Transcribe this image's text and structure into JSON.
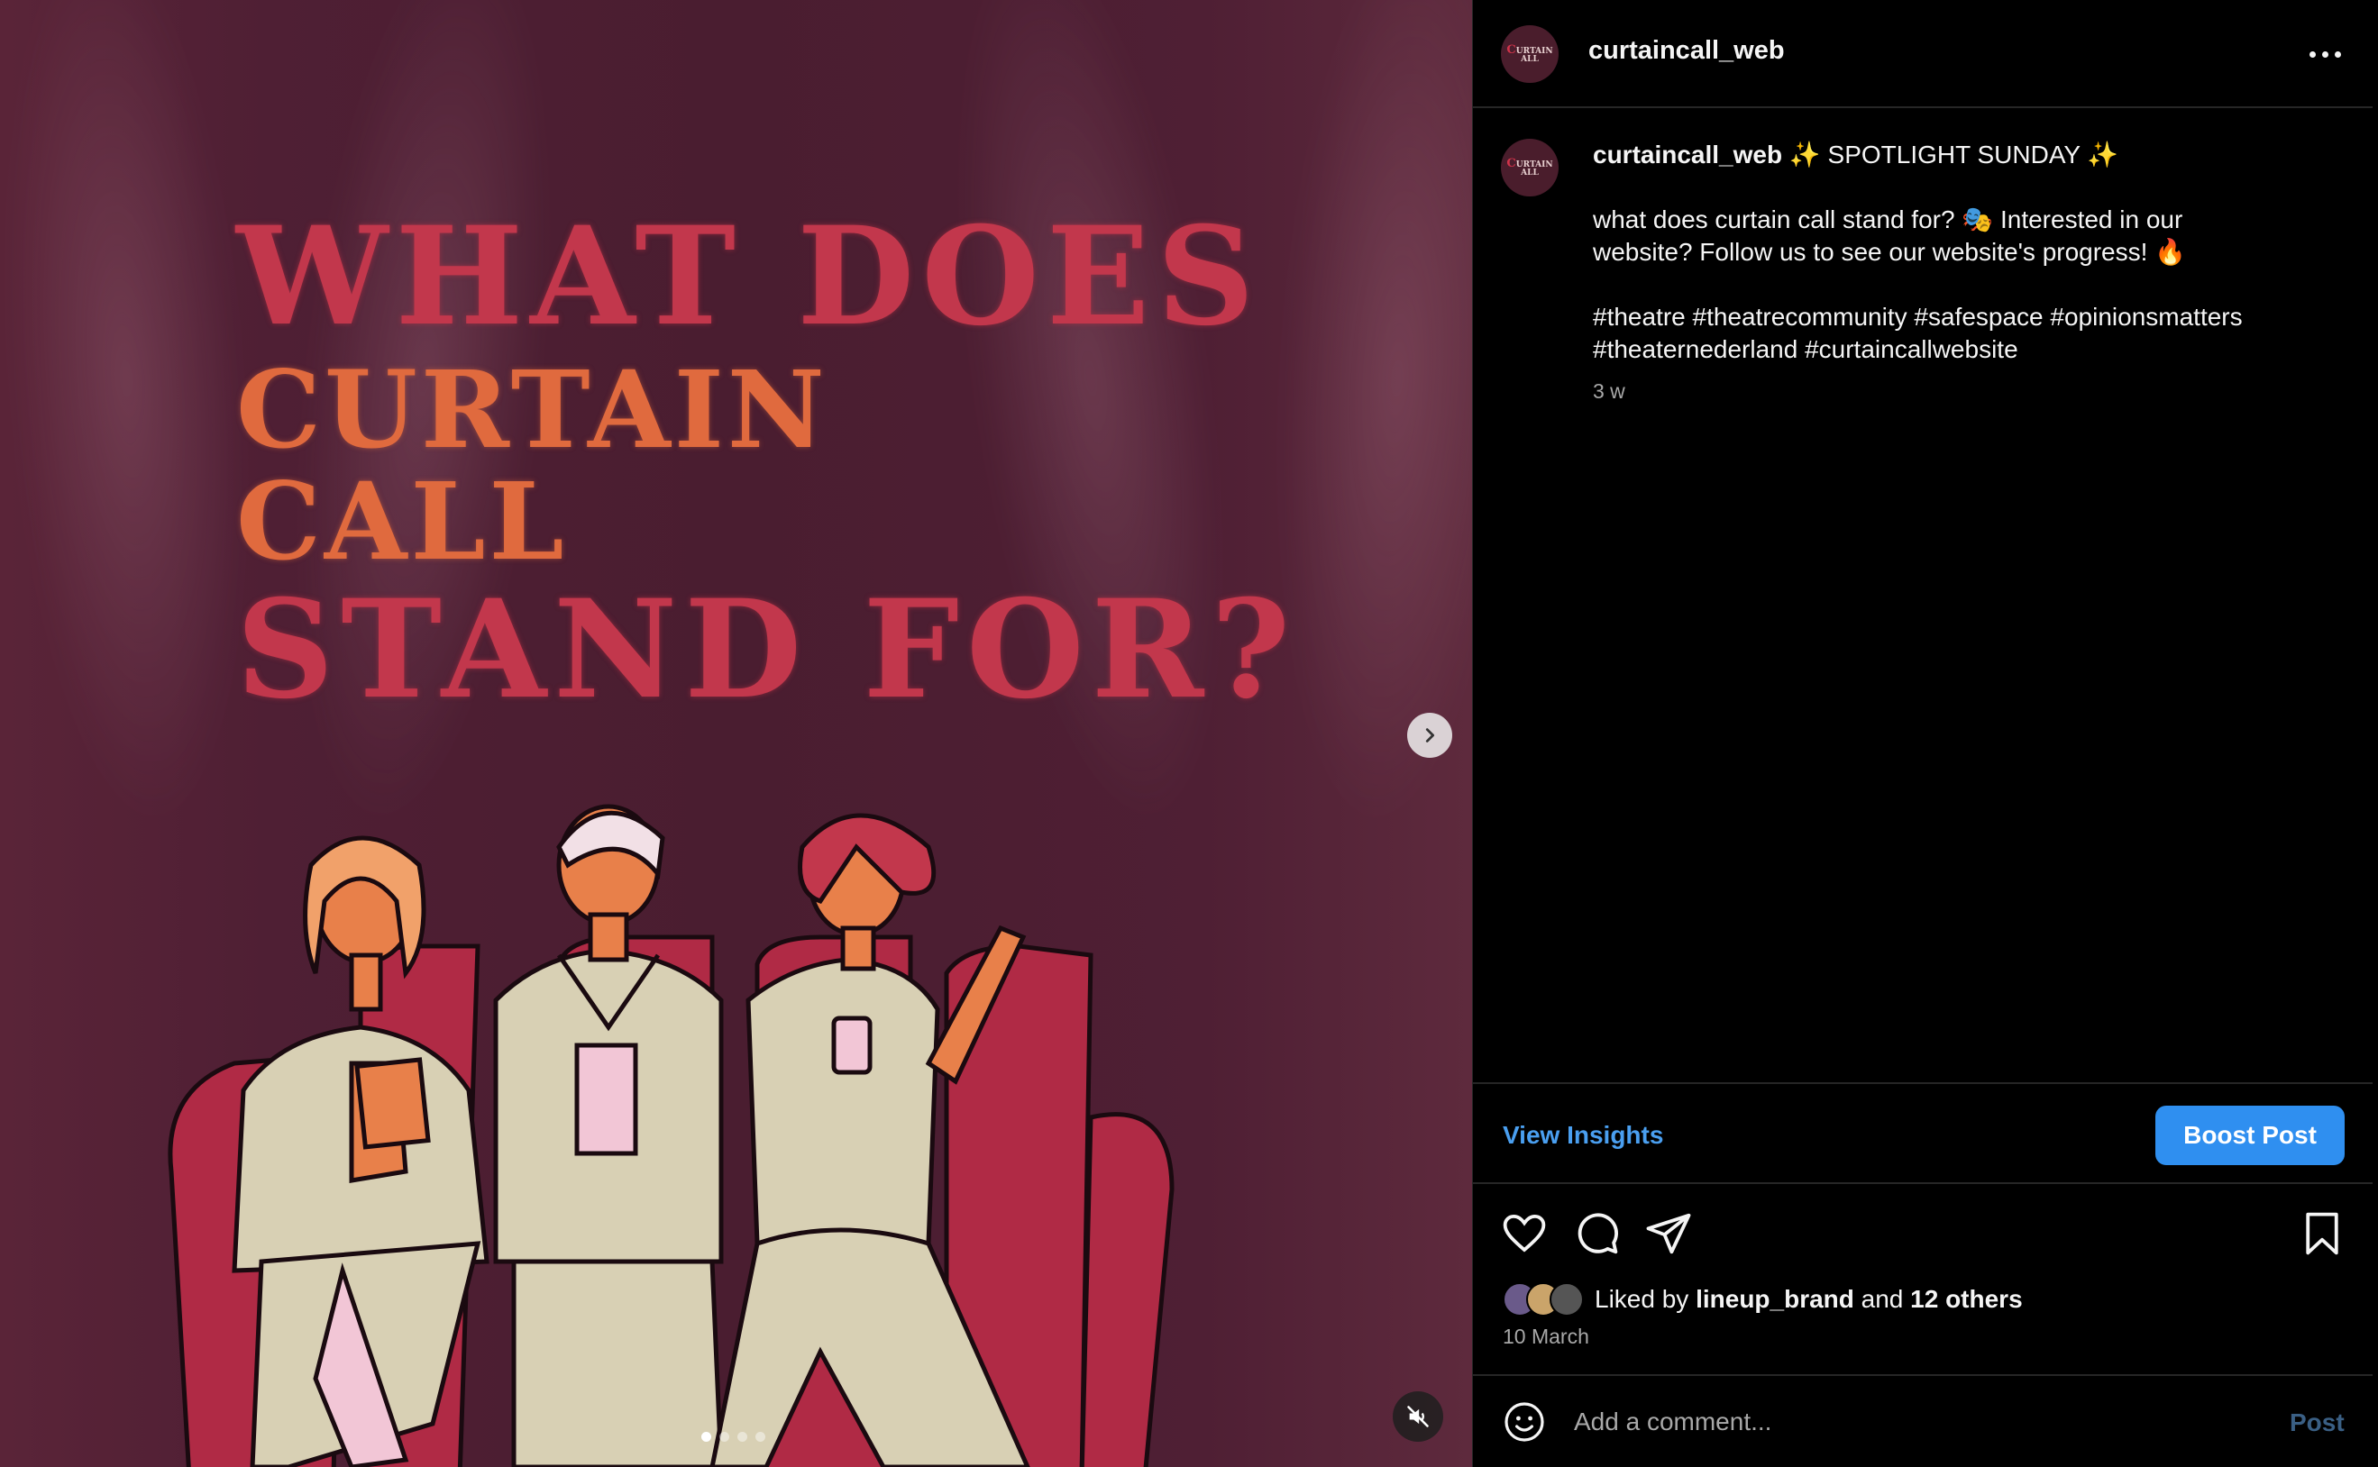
{
  "media": {
    "headline": {
      "line1": "WHAT DOES",
      "line2": "CURTAIN",
      "line3": "CALL",
      "line4": "STAND FOR?"
    },
    "carousel": {
      "total": 4,
      "active": 1
    }
  },
  "header": {
    "username": "curtaincall_web"
  },
  "caption": {
    "username": "curtaincall_web",
    "title": "✨ SPOTLIGHT SUNDAY ✨",
    "line1": "what does curtain call stand for? 🎭 Interested in our website? Follow us to see our website's progress! 🔥",
    "hashtags": "#theatre #theatrecommunity #safespace #opinionsmatters #theaternederland #curtaincallwebsite",
    "time": "3 w"
  },
  "insights": {
    "view_label": "View Insights",
    "boost_label": "Boost Post"
  },
  "likes": {
    "prefix": "Liked by",
    "user": "lineup_brand",
    "middle": "and",
    "others": "12 others"
  },
  "post_date": "10 March",
  "comment": {
    "placeholder": "Add a comment...",
    "post_label": "Post"
  },
  "colors": {
    "accent": "#2f8ff0",
    "link": "#4a9ff0",
    "background": "#000000",
    "headline_red": "#c2374c",
    "headline_orange": "#e06a3e"
  },
  "icons": [
    "heart-icon",
    "comment-icon",
    "share-icon",
    "bookmark-icon",
    "emoji-icon",
    "more-icon",
    "chevron-right-icon",
    "mute-icon"
  ]
}
